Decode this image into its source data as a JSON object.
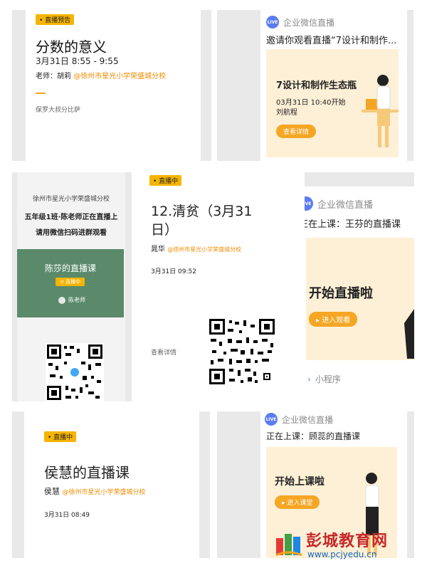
{
  "card1": {
    "badge": "• 直播预告",
    "title": "分数的意义",
    "time": "3月31日 8:55 - 9:55",
    "teacher_prefix": "老师：胡莉",
    "org": "@徐州市星光小学荣盛城分校",
    "footer": "保罗大叔分比萨"
  },
  "card2": {
    "brand": "企业微信直播",
    "invite": "邀请你观看直播“7设计和制作...",
    "inner_title": "7设计和制作生态瓶",
    "start": "03月31日 10:40开始",
    "teacher": "刘航程",
    "button": "查看详情"
  },
  "card3": {
    "school": "徐州市星光小学荣盛城分校",
    "line1": "五年级1班·陈老师正在直播上",
    "line2": "请用微信扫码进群观看",
    "live_title": "陈莎的直播课",
    "live_badge": "⊙ 直播中",
    "host": "陈老师"
  },
  "card4": {
    "badge": "• 直播中",
    "title": "12.清贫（3月31日）",
    "host": "晁华",
    "org": "@徐州市星光小学荣盛城分校",
    "time": "3月31日 09:52",
    "detail": "查看详情"
  },
  "card5": {
    "brand": "企业微信直播",
    "title": "正在上课：王芬的直播课",
    "banner": "开始直播啦",
    "button": "▸ 进入观看",
    "mini": "小程序"
  },
  "card6": {
    "badge": "• 直播中",
    "title": "侯慧的直播课",
    "host": "侯慧",
    "org": "@徐州市星光小学荣盛城分校",
    "time": "3月31日 08:49"
  },
  "card7": {
    "brand": "企业微信直播",
    "title": "正在上课：顾蕊的直播课",
    "banner": "开始上课啦",
    "button": "▸ 进入课堂"
  },
  "watermark": {
    "name": "彭城教育网",
    "url": "www.pcjyedu.cn"
  },
  "live_icon": "LIVE"
}
